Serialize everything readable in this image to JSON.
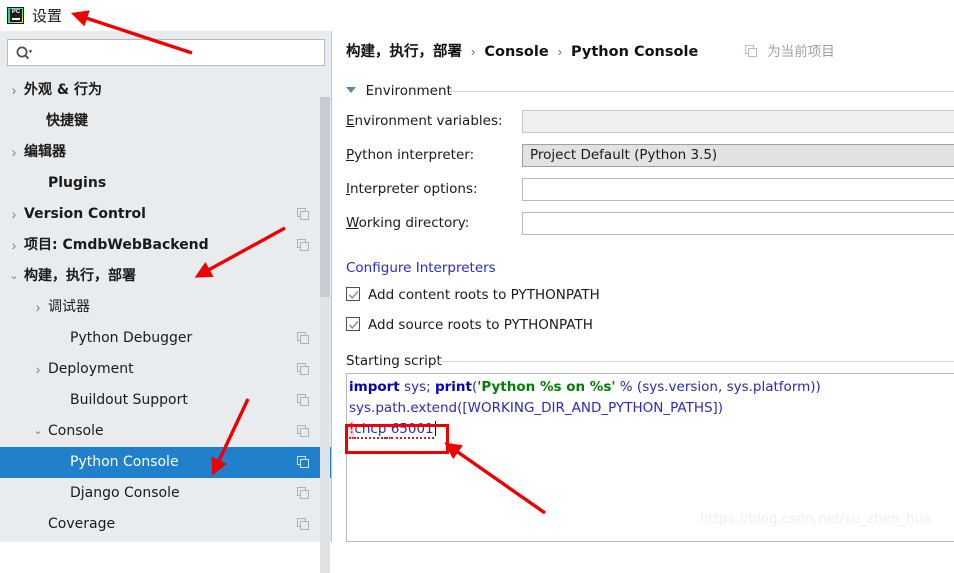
{
  "window": {
    "title": "设置",
    "logo_icon": "pycharm-logo-icon",
    "logo_text": "PC"
  },
  "sidebar": {
    "search": {
      "placeholder": "",
      "value": "",
      "icon": "search-icon"
    },
    "items": [
      {
        "label": "外观 & 行为",
        "indent": 8,
        "chevron": "right",
        "bold": true,
        "copy": false
      },
      {
        "label": "快捷键",
        "indent": 30,
        "chevron": "",
        "bold": true,
        "copy": false
      },
      {
        "label": "编辑器",
        "indent": 8,
        "chevron": "right",
        "bold": true,
        "copy": false
      },
      {
        "label": "Plugins",
        "indent": 32,
        "chevron": "",
        "bold": true,
        "copy": false
      },
      {
        "label": "Version Control",
        "indent": 8,
        "chevron": "right",
        "bold": true,
        "copy": true
      },
      {
        "label": "项目: CmdbWebBackend",
        "indent": 8,
        "chevron": "right",
        "bold": true,
        "copy": true
      },
      {
        "label": "构建，执行，部署",
        "indent": 8,
        "chevron": "down",
        "bold": true,
        "copy": false
      },
      {
        "label": "调试器",
        "indent": 32,
        "chevron": "right",
        "bold": false,
        "copy": false
      },
      {
        "label": "Python Debugger",
        "indent": 54,
        "chevron": "",
        "bold": false,
        "copy": true
      },
      {
        "label": "Deployment",
        "indent": 32,
        "chevron": "right",
        "bold": false,
        "copy": true
      },
      {
        "label": "Buildout Support",
        "indent": 54,
        "chevron": "",
        "bold": false,
        "copy": true
      },
      {
        "label": "Console",
        "indent": 32,
        "chevron": "down",
        "bold": false,
        "copy": true
      },
      {
        "label": "Python Console",
        "indent": 54,
        "chevron": "",
        "bold": false,
        "copy": true,
        "selected": true
      },
      {
        "label": "Django Console",
        "indent": 54,
        "chevron": "",
        "bold": false,
        "copy": true
      },
      {
        "label": "Coverage",
        "indent": 32,
        "chevron": "",
        "bold": false,
        "copy": true
      }
    ],
    "selected_color": "#2080cc"
  },
  "header": {
    "breadcrumb": [
      "构建，执行，部署",
      "Console",
      "Python Console"
    ],
    "separator": "›",
    "for_project_label": "为当前项目",
    "for_project_icon": "copy-icon"
  },
  "environment": {
    "section_title": "Environment",
    "fields": [
      {
        "label_pre": "E",
        "label_rest": "nvironment variables:",
        "value": "",
        "style": "disabled"
      },
      {
        "label_pre": "P",
        "label_rest": "ython interpreter:",
        "value": "Project Default (Python 3.5)",
        "style": "combo"
      },
      {
        "label_pre": "I",
        "label_rest": "nterpreter options:",
        "value": "",
        "style": "white"
      },
      {
        "label_pre": "W",
        "label_rest": "orking directory:",
        "value": "",
        "style": "white"
      }
    ],
    "configure_link": "Configure Interpreters",
    "checkboxes": [
      {
        "label": "Add content roots to PYTHONPATH",
        "checked": true
      },
      {
        "label": "Add source roots to PYTHONPATH",
        "checked": true
      }
    ]
  },
  "starting_script": {
    "section_title": "Starting script",
    "lines": [
      {
        "tokens": [
          {
            "t": "import",
            "c": "kw"
          },
          {
            "t": " sys; ",
            "c": "id"
          },
          {
            "t": "print",
            "c": "kw"
          },
          {
            "t": "(",
            "c": "blu"
          },
          {
            "t": "'Python %s on %s'",
            "c": "str"
          },
          {
            "t": " % (sys.version, sys.platform))",
            "c": "blu"
          }
        ]
      },
      {
        "tokens": [
          {
            "t": "sys.path.extend",
            "c": "blu"
          },
          {
            "t": "([WORKING_DIR_AND_PYTHON_PATHS])",
            "c": "blu"
          }
        ]
      },
      {
        "tokens": [
          {
            "t": "!",
            "c": "err-bg"
          },
          {
            "t": "chcp",
            "c": "blu"
          },
          {
            "t": " ",
            "c": "blu"
          },
          {
            "t": "65001",
            "c": "blu"
          }
        ],
        "has_caret": true,
        "highlighted": true
      }
    ],
    "highlight_color": "#ee0000"
  },
  "watermark": "https://blog.csdn.net/su_zhen_hua",
  "annotations": {
    "arrow_color": "#ee0000",
    "arrows": [
      {
        "name": "arrow-to-title"
      },
      {
        "name": "arrow-to-build-execute-deploy"
      },
      {
        "name": "arrow-to-python-console"
      },
      {
        "name": "arrow-to-chcp-line"
      }
    ]
  }
}
